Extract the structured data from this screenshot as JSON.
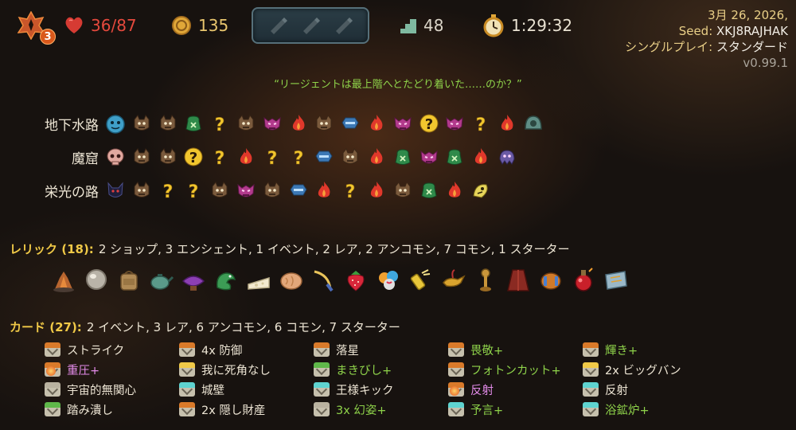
{
  "topbar": {
    "ascension": "3",
    "hp": "36/87",
    "gold": "135",
    "floor": "48",
    "time": "1:29:32"
  },
  "meta": {
    "date": "3月 26, 2026,",
    "seed_label": "Seed:",
    "seed_value": "XKJ8RAJHAK",
    "mode_label": "シングルプレイ:",
    "mode_value": "スタンダード",
    "version": "v0.99.1"
  },
  "quote": "“リージェントは最上階へとたどり着いた……のか？”",
  "acts": [
    {
      "label": "地下水路",
      "nodes": [
        "boss-blue",
        "monster",
        "monster",
        "merchant",
        "unknown",
        "monster",
        "elite",
        "rest",
        "monster",
        "treasure",
        "rest",
        "elite",
        "unknown-elite",
        "elite",
        "unknown",
        "rest",
        "boss-teal"
      ]
    },
    {
      "label": "魔窟",
      "nodes": [
        "boss-skull",
        "monster",
        "monster",
        "unknown-elite",
        "unknown",
        "rest",
        "unknown",
        "unknown",
        "treasure",
        "monster",
        "rest",
        "merchant",
        "elite",
        "merchant",
        "rest",
        "boss-purple"
      ]
    },
    {
      "label": "栄光の路",
      "nodes": [
        "boss-dark",
        "monster",
        "unknown",
        "unknown",
        "monster",
        "elite",
        "monster",
        "treasure",
        "rest",
        "unknown",
        "rest",
        "monster",
        "merchant",
        "rest",
        "boss-yellow"
      ]
    }
  ],
  "relics_section": {
    "head": "レリック (18):",
    "summary": "2 ショップ,  3 エンシェント, 1 イベント, 2 レア, 2 アンコモン, 7 コモン, 1 スターター"
  },
  "relics": [
    "ember-stone",
    "glass-orb",
    "backpack",
    "teapot",
    "purple-cushion",
    "green-dragon",
    "cheese",
    "bread",
    "whip",
    "strawberry",
    "candy",
    "fuse",
    "magic-lamp",
    "wooden-tool",
    "red-cape",
    "barrel",
    "red-potion",
    "scroll-map"
  ],
  "cards_section": {
    "head": "カード (27):",
    "summary": "2 イベント, 3 レア, 6 アンコモン, 6 コモン, 7 スターター"
  },
  "cards": [
    [
      {
        "name": "ストライク",
        "color": "white",
        "top": "#d97a2a"
      },
      {
        "name": "重圧+",
        "color": "pink",
        "top": "#d97a2a",
        "ench": true
      },
      {
        "name": "宇宙的無関心",
        "color": "white",
        "top": "#b9b2a0"
      },
      {
        "name": "踏み潰し",
        "color": "white",
        "top": "#5fb84a"
      }
    ],
    [
      {
        "name": "4x 防御",
        "color": "white",
        "top": "#d97a2a"
      },
      {
        "name": "我に死角なし",
        "color": "white",
        "top": "#f0c947"
      },
      {
        "name": "城壁",
        "color": "white",
        "top": "#5ed3d0"
      },
      {
        "name": "2x 隠し財産",
        "color": "white",
        "top": "#d97a2a"
      }
    ],
    [
      {
        "name": "落星",
        "color": "white",
        "top": "#d97a2a"
      },
      {
        "name": "まきびし+",
        "color": "green",
        "top": "#5fb84a"
      },
      {
        "name": "王様キック",
        "color": "white",
        "top": "#5ed3d0"
      },
      {
        "name": "3x 幻姿+",
        "color": "green",
        "top": "#b9b2a0"
      }
    ],
    [
      {
        "name": "畏敬+",
        "color": "green",
        "top": "#d97a2a"
      },
      {
        "name": "フォトンカット+",
        "color": "green",
        "top": "#d97a2a"
      },
      {
        "name": "反射",
        "color": "pink",
        "top": "#d97a2a",
        "ench": true
      },
      {
        "name": "予言+",
        "color": "green",
        "top": "#5ed3d0"
      }
    ],
    [
      {
        "name": "輝き+",
        "color": "green",
        "top": "#d97a2a"
      },
      {
        "name": "2x ビッグバン",
        "color": "white",
        "top": "#f0c947"
      },
      {
        "name": "反射",
        "color": "white",
        "top": "#5ed3d0"
      },
      {
        "name": "浴鉱炉+",
        "color": "green",
        "top": "#5ed3d0"
      }
    ]
  ]
}
